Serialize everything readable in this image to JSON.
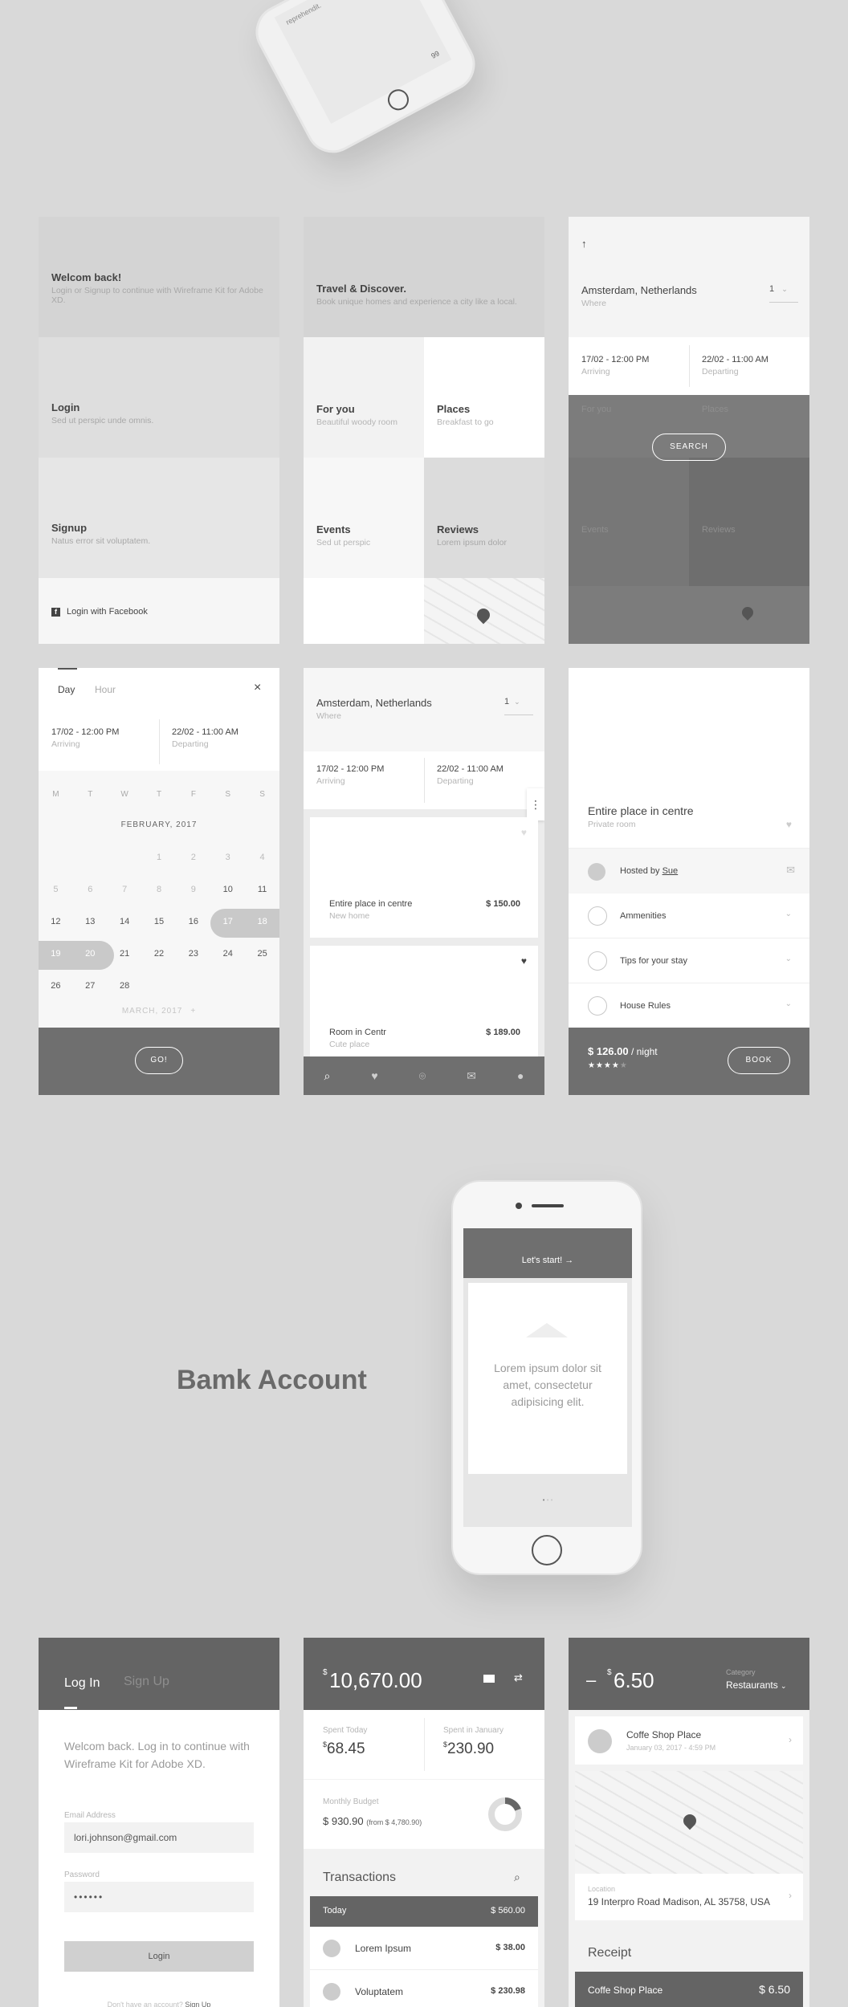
{
  "top_phone": {
    "text": "reprehendit.",
    "corner": "99"
  },
  "welcome": {
    "title": "Welcom back!",
    "subtitle": "Login or Signup to continue with Wireframe Kit for Adobe XD.",
    "login_title": "Login",
    "login_sub": "Sed ut perspic unde omnis.",
    "signup_title": "Signup",
    "signup_sub": "Natus error sit voluptatem.",
    "facebook": "Login with Facebook"
  },
  "discover": {
    "title": "Travel & Discover.",
    "subtitle": "Book unique homes and experience a city like a local.",
    "tiles": [
      {
        "title": "For you",
        "sub": "Beautiful woody room"
      },
      {
        "title": "Places",
        "sub": "Breakfast to go"
      },
      {
        "title": "Events",
        "sub": "Sed ut perspic"
      },
      {
        "title": "Reviews",
        "sub": "Lorem ipsum dolor"
      }
    ]
  },
  "search": {
    "location": "Amsterdam, Netherlands",
    "where": "Where",
    "guests": "1",
    "arriving_date": "17/02 - 12:00 PM",
    "arriving": "Arriving",
    "departing_date": "22/02 - 11:00 AM",
    "departing": "Departing",
    "button": "SEARCH"
  },
  "calendar": {
    "tab_day": "Day",
    "tab_hour": "Hour",
    "close": "×",
    "arriving_date": "17/02 - 12:00 PM",
    "arriving": "Arriving",
    "departing_date": "22/02 - 11:00 AM",
    "departing": "Departing",
    "weekdays": [
      "M",
      "T",
      "W",
      "T",
      "F",
      "S",
      "S"
    ],
    "month": "FEBRUARY, 2017",
    "rows": [
      [
        "",
        "",
        "",
        "1",
        "2",
        "3",
        "4"
      ],
      [
        "5",
        "6",
        "7",
        "8",
        "9",
        "10",
        "11"
      ],
      [
        "12",
        "13",
        "14",
        "15",
        "16",
        "17",
        "18"
      ],
      [
        "19",
        "20",
        "21",
        "22",
        "23",
        "24",
        "25"
      ],
      [
        "26",
        "27",
        "28",
        "",
        "",
        "",
        ""
      ]
    ],
    "next_month": "MARCH, 2017",
    "button": "GO!"
  },
  "results": {
    "location": "Amsterdam, Netherlands",
    "where": "Where",
    "guests": "1",
    "arriving_date": "17/02 - 12:00 PM",
    "arriving": "Arriving",
    "departing_date": "22/02 - 11:00 AM",
    "departing": "Departing",
    "cards": [
      {
        "title": "Entire place in centre",
        "sub": "New home",
        "price": "$ 150.00"
      },
      {
        "title": "Room in Centr",
        "sub": "Cute place",
        "price": "$ 189.00"
      }
    ]
  },
  "detail": {
    "title": "Entire place in centre",
    "sub": "Private room",
    "hosted_prefix": "Hosted by ",
    "host": "Sue",
    "items": [
      "Ammenities",
      "Tips for your stay",
      "House Rules"
    ],
    "price": "$ 126.00",
    "per": " / night",
    "stars": "★★★★",
    "star_empty": "★",
    "button": "BOOK"
  },
  "showcase": {
    "heading": "Bamk Account",
    "cta": "Let's start! →",
    "body": "Lorem ipsum dolor sit amet, consectetur adipisicing elit."
  },
  "login": {
    "tab_login": "Log In",
    "tab_signup": "Sign Up",
    "welcome": "Welcom back. Log in to continue with Wireframe Kit for Adobe XD.",
    "email_label": "Email Address",
    "email_value": "lori.johnson@gmail.com",
    "password_label": "Password",
    "password_value": "••••••",
    "button": "Login",
    "footer_prefix": "Don't have an account? ",
    "footer_link": "Sign Up"
  },
  "account": {
    "currency": "$",
    "balance": "10,670.00",
    "spent_today_label": "Spent Today",
    "spent_today": "68.45",
    "spent_jan_label": "Spent in January",
    "spent_jan": "230.90",
    "budget_label": "Monthly Budget",
    "budget": "$ 930.90",
    "budget_from": "(from $ 4,780.90)",
    "transactions": "Transactions",
    "today": "Today",
    "today_total": "$ 560.00",
    "rows": [
      {
        "name": "Lorem Ipsum",
        "amount": "$ 38.00"
      },
      {
        "name": "Voluptatem",
        "amount": "$ 230.98"
      }
    ]
  },
  "expense": {
    "sign": "–",
    "currency": "$",
    "amount": "6.50",
    "category_label": "Category",
    "category": "Restaurants",
    "place": "Coffe Shop Place",
    "date": "January 03, 2017 - 4:59 PM",
    "location_label": "Location",
    "address": "19 Interpro Road Madison, AL 35758, USA",
    "receipt": "Receipt",
    "receipt_name": "Coffe Shop Place",
    "receipt_amount": "$ 6.50"
  }
}
